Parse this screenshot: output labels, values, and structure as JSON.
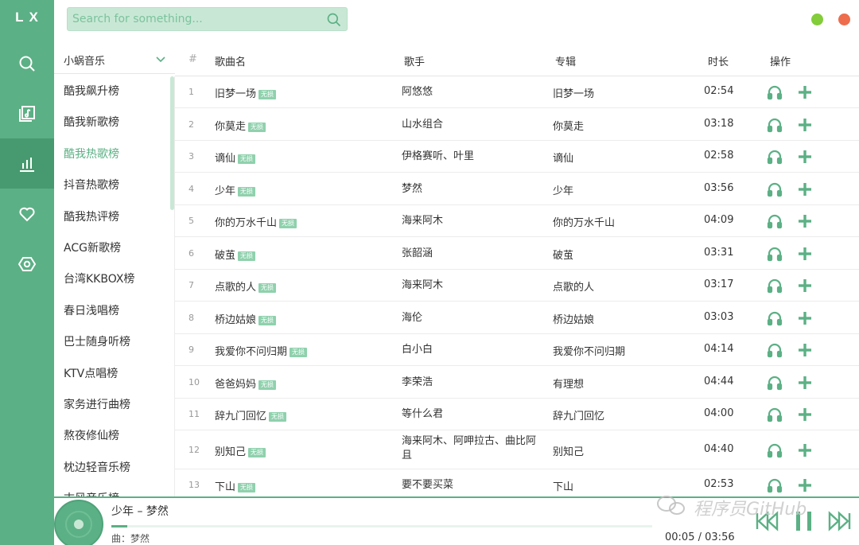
{
  "app": {
    "logo": "LX",
    "colors": {
      "accent": "#5cb085",
      "accent_dark": "#479a6f",
      "tag": "#8fd1ad",
      "window_min": "#83cc3a",
      "window_close": "#ed6d4c"
    }
  },
  "nav": [
    {
      "name": "search",
      "icon": "search-icon"
    },
    {
      "name": "songlist",
      "icon": "music-library-icon"
    },
    {
      "name": "leaderboard",
      "icon": "bar-chart-icon",
      "active": true
    },
    {
      "name": "favorites",
      "icon": "heart-icon"
    },
    {
      "name": "settings",
      "icon": "hexagon-settings-icon"
    }
  ],
  "search": {
    "placeholder": "Search for something..."
  },
  "source": {
    "selected": "小蜗音乐"
  },
  "boards": [
    "酷我飙升榜",
    "酷我新歌榜",
    "酷我热歌榜",
    "抖音热歌榜",
    "酷我热评榜",
    "ACG新歌榜",
    "台湾KKBOX榜",
    "春日浅唱榜",
    "巴士随身听榜",
    "KTV点唱榜",
    "家务进行曲榜",
    "熬夜修仙榜",
    "枕边轻音乐榜",
    "古风音乐榜"
  ],
  "active_board": "酷我热歌榜",
  "table": {
    "headers": {
      "num": "#",
      "name": "歌曲名",
      "singer": "歌手",
      "album": "专辑",
      "duration": "时长",
      "ops": "操作"
    },
    "tag_label": "无损",
    "rows": [
      {
        "num": "1",
        "name": "旧梦一场",
        "singer": "阿悠悠",
        "album": "旧梦一场",
        "duration": "02:54"
      },
      {
        "num": "2",
        "name": "你莫走",
        "singer": "山水组合",
        "album": "你莫走",
        "duration": "03:18"
      },
      {
        "num": "3",
        "name": "谪仙",
        "singer": "伊格赛听、叶里",
        "album": "谪仙",
        "duration": "02:58"
      },
      {
        "num": "4",
        "name": "少年",
        "singer": "梦然",
        "album": "少年",
        "duration": "03:56"
      },
      {
        "num": "5",
        "name": "你的万水千山",
        "singer": "海来阿木",
        "album": "你的万水千山",
        "duration": "04:09"
      },
      {
        "num": "6",
        "name": "破茧",
        "singer": "张韶涵",
        "album": "破茧",
        "duration": "03:31"
      },
      {
        "num": "7",
        "name": "点歌的人",
        "singer": "海来阿木",
        "album": "点歌的人",
        "duration": "03:17"
      },
      {
        "num": "8",
        "name": "桥边姑娘",
        "singer": "海伦",
        "album": "桥边姑娘",
        "duration": "03:03"
      },
      {
        "num": "9",
        "name": "我爱你不问归期",
        "singer": "白小白",
        "album": "我爱你不问归期",
        "duration": "04:14"
      },
      {
        "num": "10",
        "name": "爸爸妈妈",
        "singer": "李荣浩",
        "album": "有理想",
        "duration": "04:44"
      },
      {
        "num": "11",
        "name": "辞九门回忆",
        "singer": "等什么君",
        "album": "辞九门回忆",
        "duration": "04:00"
      },
      {
        "num": "12",
        "name": "别知己",
        "singer": "海来阿木、阿呷拉古、曲比阿且",
        "album": "别知己",
        "duration": "04:40"
      },
      {
        "num": "13",
        "name": "下山",
        "singer": "要不要买菜",
        "album": "下山",
        "duration": "02:53"
      }
    ]
  },
  "player": {
    "title": "少年 – 梦然",
    "lyric": "曲：梦然",
    "current": "00:05",
    "separator": "/",
    "total": "03:56",
    "progress": 0.03
  },
  "watermark": "程序员GitHub"
}
